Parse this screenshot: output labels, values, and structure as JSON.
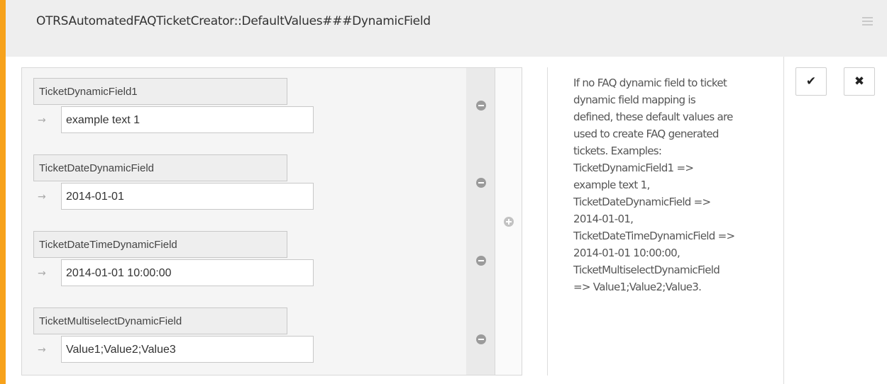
{
  "header": {
    "title": "OTRSAutomatedFAQTicketCreator::DefaultValues###DynamicField"
  },
  "hash_rows": [
    {
      "key": "TicketDynamicField1",
      "value": "example text 1"
    },
    {
      "key": "TicketDateDynamicField",
      "value": "2014-01-01"
    },
    {
      "key": "TicketDateTimeDynamicField",
      "value": "2014-01-01 10:00:00"
    },
    {
      "key": "TicketMultiselectDynamicField",
      "value": "Value1;Value2;Value3"
    }
  ],
  "description_lines": [
    "If no FAQ dynamic field to ticket",
    "dynamic field mapping is",
    "defined, these default values are",
    "used to create FAQ generated",
    "tickets. Examples:",
    "TicketDynamicField1 =>",
    "example text 1,",
    "TicketDateDynamicField =>",
    "2014-01-01,",
    "TicketDateTimeDynamicField =>",
    "2014-01-01 10:00:00,",
    "TicketMultiselectDynamicField",
    "=> Value1;Value2;Value3."
  ],
  "actions": {
    "save_icon": "✔",
    "cancel_icon": "✖"
  },
  "colors": {
    "accent": "#f7a21b"
  },
  "icons": {
    "arrow": "→",
    "menu": "hamburger-menu-icon",
    "remove": "minus-circle-icon",
    "add": "plus-circle-icon"
  }
}
